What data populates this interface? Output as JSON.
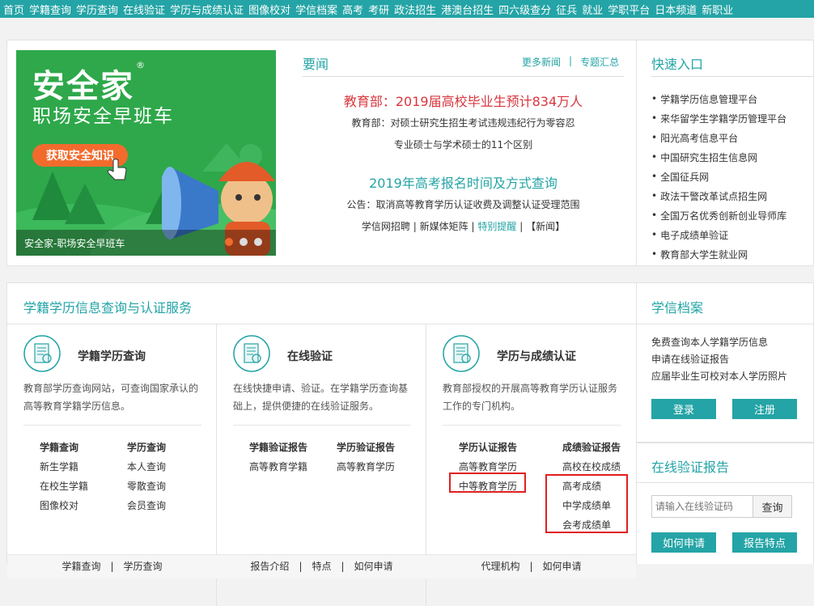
{
  "nav": [
    "首页",
    "学籍查询",
    "学历查询",
    "在线验证",
    "学历与成绩认证",
    "图像校对",
    "学信档案",
    "高考",
    "考研",
    "政法招生",
    "港澳台招生",
    "四六级查分",
    "征兵",
    "就业",
    "学职平台",
    "日本频道",
    "新职业"
  ],
  "banner": {
    "logo_title": "安全家",
    "reg_mark": "®",
    "subtitle": "职场安全早班车",
    "button": "获取安全知识",
    "caption": "安全家-职场安全早班车"
  },
  "news": {
    "title": "要闻",
    "more": "更多新闻",
    "sep": "|",
    "topics": "专题汇总",
    "headline1": "教育部：2019届高校毕业生预计834万人",
    "line1": "教育部：对硕士研究生招生考试违规违纪行为零容忍",
    "line2": "专业硕士与学术硕士的11个区别",
    "headline2": "2019年高考报名时间及方式查询",
    "line3": "公告：取消高等教育学历认证收费及调整认证受理范围",
    "bottom": {
      "a": "学信网招聘",
      "s1": "|",
      "b": "新媒体矩阵",
      "s2": "|",
      "c": "特别提醒",
      "s3": "|",
      "d": "【新闻】"
    }
  },
  "quick": {
    "title": "快速入口",
    "items": [
      "学籍学历信息管理平台",
      "来华留学生学籍学历管理平台",
      "阳光高考信息平台",
      "中国研究生招生信息网",
      "全国征兵网",
      "政法干警改革试点招生网",
      "全国万名优秀创新创业导师库",
      "电子成绩单验证",
      "教育部大学生就业网"
    ]
  },
  "services": {
    "title": "学籍学历信息查询与认证服务",
    "cards": [
      {
        "name": "学籍学历查询",
        "desc": "教育部学历查询网站，可查询国家承认的高等教育学籍学历信息。",
        "col1": {
          "head": "学籍查询",
          "items": [
            "新生学籍",
            "在校生学籍",
            "图像校对"
          ]
        },
        "col2": {
          "head": "学历查询",
          "items": [
            "本人查询",
            "零散查询",
            "会员查询"
          ]
        },
        "footer": [
          "学籍查询",
          "|",
          "学历查询"
        ]
      },
      {
        "name": "在线验证",
        "desc": "在线快捷申请、验证。在学籍学历查询基础上，提供便捷的在线验证服务。",
        "col1": {
          "head": "学籍验证报告",
          "items": [
            "高等教育学籍"
          ]
        },
        "col2": {
          "head": "学历验证报告",
          "items": [
            "高等教育学历"
          ]
        },
        "footer": [
          "报告介绍",
          "|",
          "特点",
          "|",
          "如何申请"
        ]
      },
      {
        "name": "学历与成绩认证",
        "desc": "教育部授权的开展高等教育学历认证服务工作的专门机构。",
        "col1": {
          "head": "学历认证报告",
          "items": [
            "高等教育学历",
            "中等教育学历"
          ]
        },
        "col2": {
          "head": "成绩验证报告",
          "items": [
            "高校在校成绩",
            "高考成绩",
            "中学成绩单",
            "会考成绩单"
          ]
        },
        "footer": [
          "代理机构",
          "|",
          "如何申请"
        ]
      }
    ]
  },
  "archive": {
    "title": "学信档案",
    "items": [
      "免费查询本人学籍学历信息",
      "申请在线验证报告",
      "应届毕业生可校对本人学历照片"
    ],
    "login": "登录",
    "register": "注册"
  },
  "verify": {
    "title": "在线验证报告",
    "placeholder": "请输入在线验证码",
    "query": "查询",
    "how": "如何申请",
    "features": "报告特点"
  },
  "colors": {
    "accent": "#24a4a6",
    "headline_red": "#d9363e",
    "highlight": "#e02020"
  }
}
